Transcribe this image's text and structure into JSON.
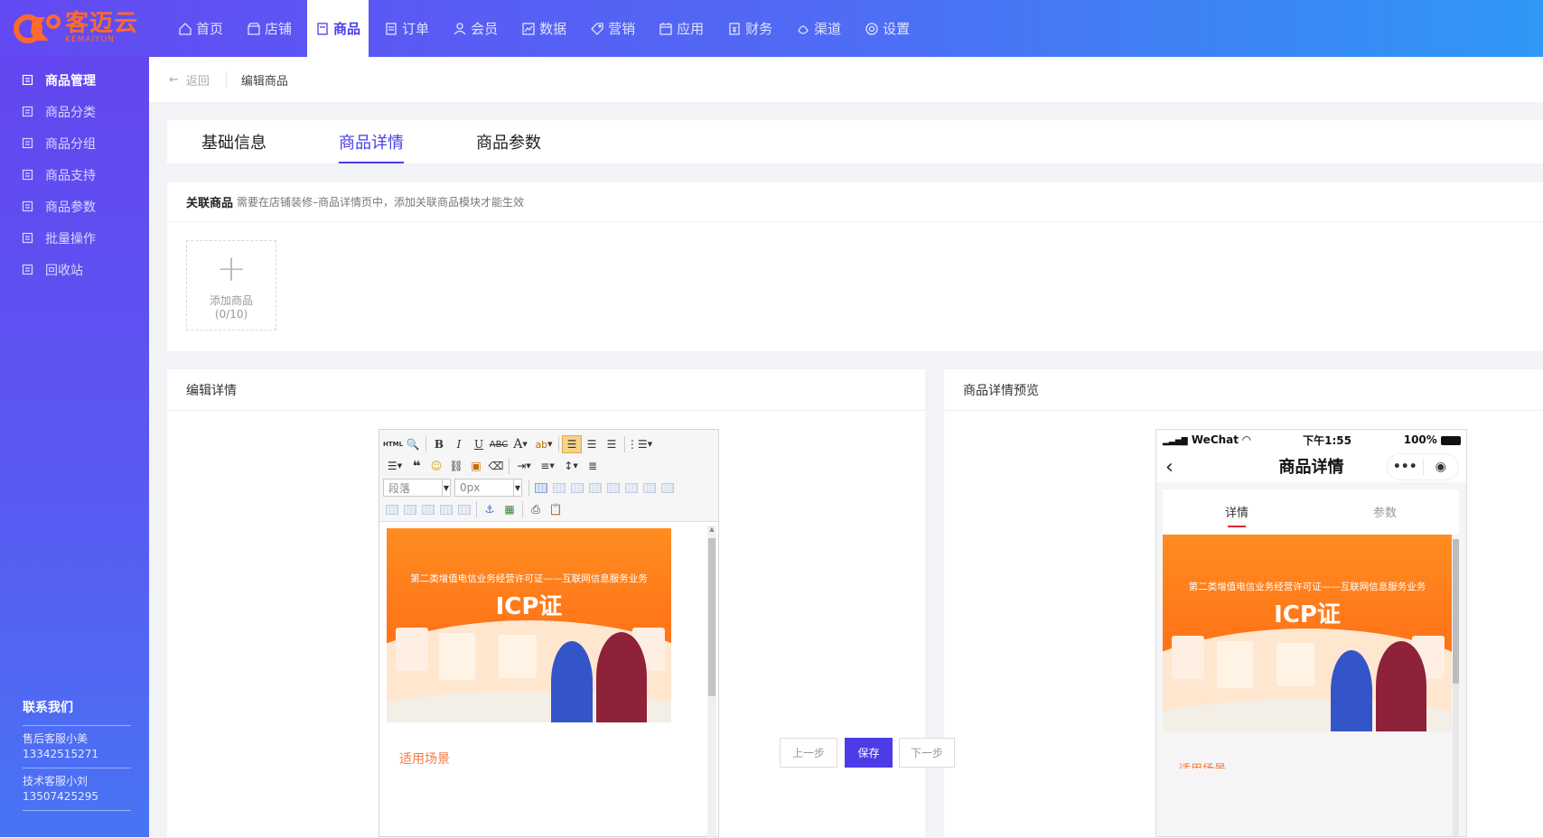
{
  "brand": {
    "name": "客迈云",
    "sub": "KEMAIYUN",
    "color": "#ff6a2c"
  },
  "nav": [
    {
      "label": "首页",
      "icon": "home-icon"
    },
    {
      "label": "店铺",
      "icon": "store-icon"
    },
    {
      "label": "商品",
      "icon": "goods-icon",
      "active": true
    },
    {
      "label": "订单",
      "icon": "order-icon"
    },
    {
      "label": "会员",
      "icon": "member-icon"
    },
    {
      "label": "数据",
      "icon": "chart-icon"
    },
    {
      "label": "营销",
      "icon": "tag-icon"
    },
    {
      "label": "应用",
      "icon": "app-icon"
    },
    {
      "label": "财务",
      "icon": "finance-icon"
    },
    {
      "label": "渠道",
      "icon": "channel-icon"
    },
    {
      "label": "设置",
      "icon": "settings-icon"
    }
  ],
  "sidebar": {
    "items": [
      {
        "label": "商品管理",
        "icon": "goods-manage-icon",
        "active": true
      },
      {
        "label": "商品分类",
        "icon": "category-icon"
      },
      {
        "label": "商品分组",
        "icon": "group-icon"
      },
      {
        "label": "商品支持",
        "icon": "thumb-icon"
      },
      {
        "label": "商品参数",
        "icon": "param-icon"
      },
      {
        "label": "批量操作",
        "icon": "batch-icon"
      },
      {
        "label": "回收站",
        "icon": "recycle-icon"
      }
    ],
    "contact": {
      "title": "联系我们",
      "entries": [
        {
          "name": "售后客服小美",
          "phone": "13342515271"
        },
        {
          "name": "技术客服小刘",
          "phone": "13507425295"
        }
      ]
    }
  },
  "breadcrumb": {
    "back": "返回",
    "title": "编辑商品"
  },
  "tabs": [
    {
      "label": "基础信息"
    },
    {
      "label": "商品详情",
      "active": true
    },
    {
      "label": "商品参数"
    }
  ],
  "related": {
    "title": "关联商品",
    "tip": "需要在店铺装修–商品详情页中，添加关联商品模块才能生效",
    "add_label": "添加商品",
    "add_count": "(0/10)"
  },
  "editor": {
    "title": "编辑详情",
    "paragraph_select": "段落",
    "size_select": "0px",
    "banner_sub": "第二类增值电信业务经营许可证——互联网信息服务业务",
    "banner_title": "ICP证",
    "scene_title": "适用场景"
  },
  "preview": {
    "title": "商品详情预览",
    "carrier": "WeChat",
    "time": "下午1:55",
    "battery": "100%",
    "page_title": "商品详情",
    "tabs": [
      "详情",
      "参数"
    ],
    "banner_sub": "第二类增值电信业务经营许可证——互联网信息服务业务",
    "banner_title": "ICP证",
    "tail": "适用场景"
  },
  "footer": {
    "prev": "上一步",
    "save": "保存",
    "next": "下一步"
  },
  "colors": {
    "accent": "#4a3ee8",
    "primary_button": "#4c3ce6",
    "banner": "#ff7a1a"
  }
}
